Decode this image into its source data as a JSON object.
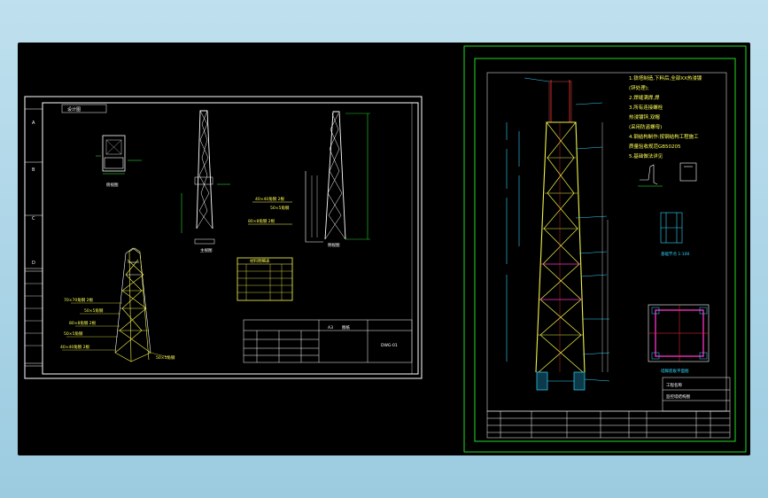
{
  "left_sheet": {
    "title_tag": "设计图",
    "views": {
      "top_view_label": "俯视图",
      "front_view_label": "主视图",
      "side_view_label": "侧视图"
    },
    "callouts": [
      "40×40角钢 2根",
      "50×5角钢",
      "80×8角钢 2根",
      "50×5角钢",
      "70×70角钢 2根"
    ],
    "table_header": "材料明细表",
    "title_block": {
      "cell_a": "A3",
      "cell_b": "图纸",
      "drawing_no": "DWG-01"
    }
  },
  "right_sheet": {
    "notes": [
      "1.铁塔制造,下料后,全部XX热浸镀",
      "(锌处理);",
      "2.焊缝满焊,焊",
      "3.所有连接螺栓",
      "热浸镀锌,双帽",
      "(采用防盗螺母)",
      "4.钢结构制作:按钢结构工程施工",
      "质量验收规范GB50205",
      "5.基础做法详见"
    ],
    "section_label": "基础节点 1:100",
    "plan_label": "塔脚底板平面图",
    "title_block": {
      "project": "工程名称",
      "drawing_name": "监控塔结构图"
    }
  },
  "colors": {
    "bg": "#000000",
    "frame_white": "#ffffff",
    "frame_green": "#22dd22",
    "tower_yellow": "#f2f24a",
    "dim_green": "#33ff33",
    "accent_red": "#ff3030",
    "accent_magenta": "#ff33cc",
    "cyan": "#33d6ff",
    "text_yellow": "#ffff55"
  }
}
